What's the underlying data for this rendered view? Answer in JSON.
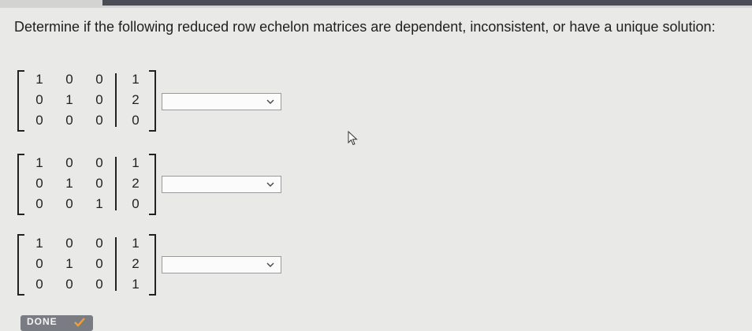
{
  "question": "Determine if the following reduced row echelon matrices are dependent, inconsistent, or have a unique solution:",
  "matrices": [
    {
      "rows": [
        [
          "1",
          "0",
          "0",
          "1"
        ],
        [
          "0",
          "1",
          "0",
          "2"
        ],
        [
          "0",
          "0",
          "0",
          "0"
        ]
      ],
      "answer": ""
    },
    {
      "rows": [
        [
          "1",
          "0",
          "0",
          "1"
        ],
        [
          "0",
          "1",
          "0",
          "2"
        ],
        [
          "0",
          "0",
          "1",
          "0"
        ]
      ],
      "answer": ""
    },
    {
      "rows": [
        [
          "1",
          "0",
          "0",
          "1"
        ],
        [
          "0",
          "1",
          "0",
          "2"
        ],
        [
          "0",
          "0",
          "0",
          "1"
        ]
      ],
      "answer": ""
    }
  ],
  "done_button": "DONE",
  "icons": {
    "dropdown": "chevron-down-icon",
    "done": "check-icon",
    "cursor": "mouse-pointer-icon"
  },
  "colors": {
    "done_check": "#f0a030"
  }
}
